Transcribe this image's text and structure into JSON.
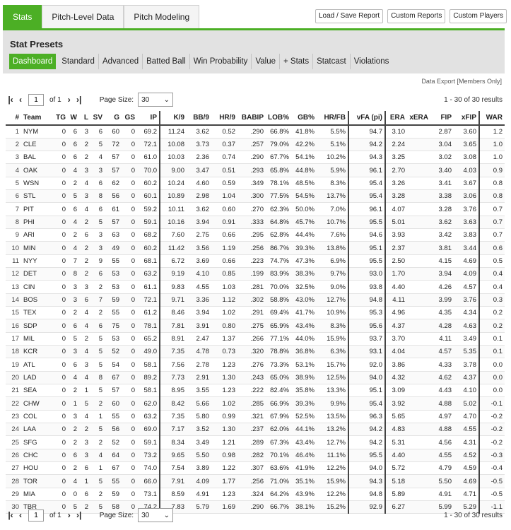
{
  "tabs": [
    {
      "label": "Stats",
      "active": true
    },
    {
      "label": "Pitch-Level Data",
      "active": false
    },
    {
      "label": "Pitch Modeling",
      "active": false
    }
  ],
  "buttons": {
    "load_save": "Load / Save Report",
    "custom_reports": "Custom Reports",
    "custom_players": "Custom Players"
  },
  "presets": {
    "title": "Stat Presets",
    "items": [
      "Dashboard",
      "Standard",
      "Advanced",
      "Batted Ball",
      "Win Probability",
      "Value",
      "+ Stats",
      "Statcast",
      "Violations"
    ],
    "active": "Dashboard"
  },
  "export": {
    "label": "Data Export",
    "members": "[Members Only]"
  },
  "pager": {
    "page": "1",
    "of_label": "of 1",
    "page_size_label": "Page Size:",
    "page_size": "30",
    "count": "1 - 30 of 30 results"
  },
  "columns": [
    "#",
    "Team",
    "TG",
    "W",
    "L",
    "SV",
    "G",
    "GS",
    "IP",
    "K/9",
    "BB/9",
    "HR/9",
    "BABIP",
    "LOB%",
    "GB%",
    "HR/FB",
    "vFA (pi)",
    "ERA",
    "xERA",
    "FIP",
    "xFIP",
    "WAR"
  ],
  "rows": [
    [
      "1",
      "NYM",
      "0",
      "6",
      "3",
      "6",
      "60",
      "0",
      "69.2",
      "11.24",
      "3.62",
      "0.52",
      ".290",
      "66.8%",
      "41.8%",
      "5.5%",
      "94.7",
      "3.10",
      "",
      "2.87",
      "3.60",
      "1.2"
    ],
    [
      "2",
      "CLE",
      "0",
      "6",
      "2",
      "5",
      "72",
      "0",
      "72.1",
      "10.08",
      "3.73",
      "0.37",
      ".257",
      "79.0%",
      "42.2%",
      "5.1%",
      "94.2",
      "2.24",
      "",
      "3.04",
      "3.65",
      "1.0"
    ],
    [
      "3",
      "BAL",
      "0",
      "6",
      "2",
      "4",
      "57",
      "0",
      "61.0",
      "10.03",
      "2.36",
      "0.74",
      ".290",
      "67.7%",
      "54.1%",
      "10.2%",
      "94.3",
      "3.25",
      "",
      "3.02",
      "3.08",
      "1.0"
    ],
    [
      "4",
      "OAK",
      "0",
      "4",
      "3",
      "3",
      "57",
      "0",
      "70.0",
      "9.00",
      "3.47",
      "0.51",
      ".293",
      "65.8%",
      "44.8%",
      "5.9%",
      "96.1",
      "2.70",
      "",
      "3.40",
      "4.03",
      "0.9"
    ],
    [
      "5",
      "WSN",
      "0",
      "2",
      "4",
      "6",
      "62",
      "0",
      "60.2",
      "10.24",
      "4.60",
      "0.59",
      ".349",
      "78.1%",
      "48.5%",
      "8.3%",
      "95.4",
      "3.26",
      "",
      "3.41",
      "3.67",
      "0.8"
    ],
    [
      "6",
      "STL",
      "0",
      "5",
      "3",
      "8",
      "56",
      "0",
      "60.1",
      "10.89",
      "2.98",
      "1.04",
      ".300",
      "77.5%",
      "54.5%",
      "13.7%",
      "95.4",
      "3.28",
      "",
      "3.38",
      "3.06",
      "0.8"
    ],
    [
      "7",
      "PIT",
      "0",
      "6",
      "4",
      "6",
      "61",
      "0",
      "59.2",
      "10.11",
      "3.62",
      "0.60",
      ".270",
      "62.3%",
      "50.0%",
      "7.0%",
      "96.1",
      "4.07",
      "",
      "3.28",
      "3.76",
      "0.7"
    ],
    [
      "8",
      "PHI",
      "0",
      "4",
      "2",
      "5",
      "57",
      "0",
      "59.1",
      "10.16",
      "3.94",
      "0.91",
      ".333",
      "64.8%",
      "45.7%",
      "10.7%",
      "95.5",
      "5.01",
      "",
      "3.62",
      "3.63",
      "0.7"
    ],
    [
      "9",
      "ARI",
      "0",
      "2",
      "6",
      "3",
      "63",
      "0",
      "68.2",
      "7.60",
      "2.75",
      "0.66",
      ".295",
      "62.8%",
      "44.4%",
      "7.6%",
      "94.6",
      "3.93",
      "",
      "3.42",
      "3.83",
      "0.7"
    ],
    [
      "10",
      "MIN",
      "0",
      "4",
      "2",
      "3",
      "49",
      "0",
      "60.2",
      "11.42",
      "3.56",
      "1.19",
      ".256",
      "86.7%",
      "39.3%",
      "13.8%",
      "95.1",
      "2.37",
      "",
      "3.81",
      "3.44",
      "0.6"
    ],
    [
      "11",
      "NYY",
      "0",
      "7",
      "2",
      "9",
      "55",
      "0",
      "68.1",
      "6.72",
      "3.69",
      "0.66",
      ".223",
      "74.7%",
      "47.3%",
      "6.9%",
      "95.5",
      "2.50",
      "",
      "4.15",
      "4.69",
      "0.5"
    ],
    [
      "12",
      "DET",
      "0",
      "8",
      "2",
      "6",
      "53",
      "0",
      "63.2",
      "9.19",
      "4.10",
      "0.85",
      ".199",
      "83.9%",
      "38.3%",
      "9.7%",
      "93.0",
      "1.70",
      "",
      "3.94",
      "4.09",
      "0.4"
    ],
    [
      "13",
      "CIN",
      "0",
      "3",
      "3",
      "2",
      "53",
      "0",
      "61.1",
      "9.83",
      "4.55",
      "1.03",
      ".281",
      "70.0%",
      "32.5%",
      "9.0%",
      "93.8",
      "4.40",
      "",
      "4.26",
      "4.57",
      "0.4"
    ],
    [
      "14",
      "BOS",
      "0",
      "3",
      "6",
      "7",
      "59",
      "0",
      "72.1",
      "9.71",
      "3.36",
      "1.12",
      ".302",
      "58.8%",
      "43.0%",
      "12.7%",
      "94.8",
      "4.11",
      "",
      "3.99",
      "3.76",
      "0.3"
    ],
    [
      "15",
      "TEX",
      "0",
      "2",
      "4",
      "2",
      "55",
      "0",
      "61.2",
      "8.46",
      "3.94",
      "1.02",
      ".291",
      "69.4%",
      "41.7%",
      "10.9%",
      "95.3",
      "4.96",
      "",
      "4.35",
      "4.34",
      "0.2"
    ],
    [
      "16",
      "SDP",
      "0",
      "6",
      "4",
      "6",
      "75",
      "0",
      "78.1",
      "7.81",
      "3.91",
      "0.80",
      ".275",
      "65.9%",
      "43.4%",
      "8.3%",
      "95.6",
      "4.37",
      "",
      "4.28",
      "4.63",
      "0.2"
    ],
    [
      "17",
      "MIL",
      "0",
      "5",
      "2",
      "5",
      "53",
      "0",
      "65.2",
      "8.91",
      "2.47",
      "1.37",
      ".266",
      "77.1%",
      "44.0%",
      "15.9%",
      "93.7",
      "3.70",
      "",
      "4.11",
      "3.49",
      "0.1"
    ],
    [
      "18",
      "KCR",
      "0",
      "3",
      "4",
      "5",
      "52",
      "0",
      "49.0",
      "7.35",
      "4.78",
      "0.73",
      ".320",
      "78.8%",
      "36.8%",
      "6.3%",
      "93.1",
      "4.04",
      "",
      "4.57",
      "5.35",
      "0.1"
    ],
    [
      "19",
      "ATL",
      "0",
      "6",
      "3",
      "5",
      "54",
      "0",
      "58.1",
      "7.56",
      "2.78",
      "1.23",
      ".276",
      "73.3%",
      "53.1%",
      "15.7%",
      "92.0",
      "3.86",
      "",
      "4.33",
      "3.78",
      "0.0"
    ],
    [
      "20",
      "LAD",
      "0",
      "4",
      "4",
      "8",
      "67",
      "0",
      "89.2",
      "7.73",
      "2.91",
      "1.30",
      ".243",
      "65.0%",
      "38.9%",
      "12.5%",
      "94.0",
      "4.32",
      "",
      "4.62",
      "4.37",
      "0.0"
    ],
    [
      "21",
      "SEA",
      "0",
      "2",
      "1",
      "5",
      "57",
      "0",
      "58.1",
      "8.95",
      "3.55",
      "1.23",
      ".222",
      "82.4%",
      "35.8%",
      "13.3%",
      "95.1",
      "3.09",
      "",
      "4.43",
      "4.10",
      "0.0"
    ],
    [
      "22",
      "CHW",
      "0",
      "1",
      "5",
      "2",
      "60",
      "0",
      "62.0",
      "8.42",
      "5.66",
      "1.02",
      ".285",
      "66.9%",
      "39.3%",
      "9.9%",
      "95.4",
      "3.92",
      "",
      "4.88",
      "5.02",
      "-0.1"
    ],
    [
      "23",
      "COL",
      "0",
      "3",
      "4",
      "1",
      "55",
      "0",
      "63.2",
      "7.35",
      "5.80",
      "0.99",
      ".321",
      "67.9%",
      "52.5%",
      "13.5%",
      "96.3",
      "5.65",
      "",
      "4.97",
      "4.70",
      "-0.2"
    ],
    [
      "24",
      "LAA",
      "0",
      "2",
      "2",
      "5",
      "56",
      "0",
      "69.0",
      "7.17",
      "3.52",
      "1.30",
      ".237",
      "62.0%",
      "44.1%",
      "13.2%",
      "94.2",
      "4.83",
      "",
      "4.88",
      "4.55",
      "-0.2"
    ],
    [
      "25",
      "SFG",
      "0",
      "2",
      "3",
      "2",
      "52",
      "0",
      "59.1",
      "8.34",
      "3.49",
      "1.21",
      ".289",
      "67.3%",
      "43.4%",
      "12.7%",
      "94.2",
      "5.31",
      "",
      "4.56",
      "4.31",
      "-0.2"
    ],
    [
      "26",
      "CHC",
      "0",
      "6",
      "3",
      "4",
      "64",
      "0",
      "73.2",
      "9.65",
      "5.50",
      "0.98",
      ".282",
      "70.1%",
      "46.4%",
      "11.1%",
      "95.5",
      "4.40",
      "",
      "4.55",
      "4.52",
      "-0.3"
    ],
    [
      "27",
      "HOU",
      "0",
      "2",
      "6",
      "1",
      "67",
      "0",
      "74.0",
      "7.54",
      "3.89",
      "1.22",
      ".307",
      "63.6%",
      "41.9%",
      "12.2%",
      "94.0",
      "5.72",
      "",
      "4.79",
      "4.59",
      "-0.4"
    ],
    [
      "28",
      "TOR",
      "0",
      "4",
      "1",
      "5",
      "55",
      "0",
      "66.0",
      "7.91",
      "4.09",
      "1.77",
      ".256",
      "71.0%",
      "35.1%",
      "15.9%",
      "94.3",
      "5.18",
      "",
      "5.50",
      "4.69",
      "-0.5"
    ],
    [
      "29",
      "MIA",
      "0",
      "0",
      "6",
      "2",
      "59",
      "0",
      "73.1",
      "8.59",
      "4.91",
      "1.23",
      ".324",
      "64.2%",
      "43.9%",
      "12.2%",
      "94.8",
      "5.89",
      "",
      "4.91",
      "4.71",
      "-0.5"
    ],
    [
      "30",
      "TBR",
      "0",
      "5",
      "2",
      "5",
      "58",
      "0",
      "74.2",
      "7.83",
      "5.79",
      "1.69",
      ".290",
      "66.7%",
      "38.1%",
      "15.2%",
      "92.9",
      "6.27",
      "",
      "5.99",
      "5.29",
      "-1.1"
    ]
  ]
}
